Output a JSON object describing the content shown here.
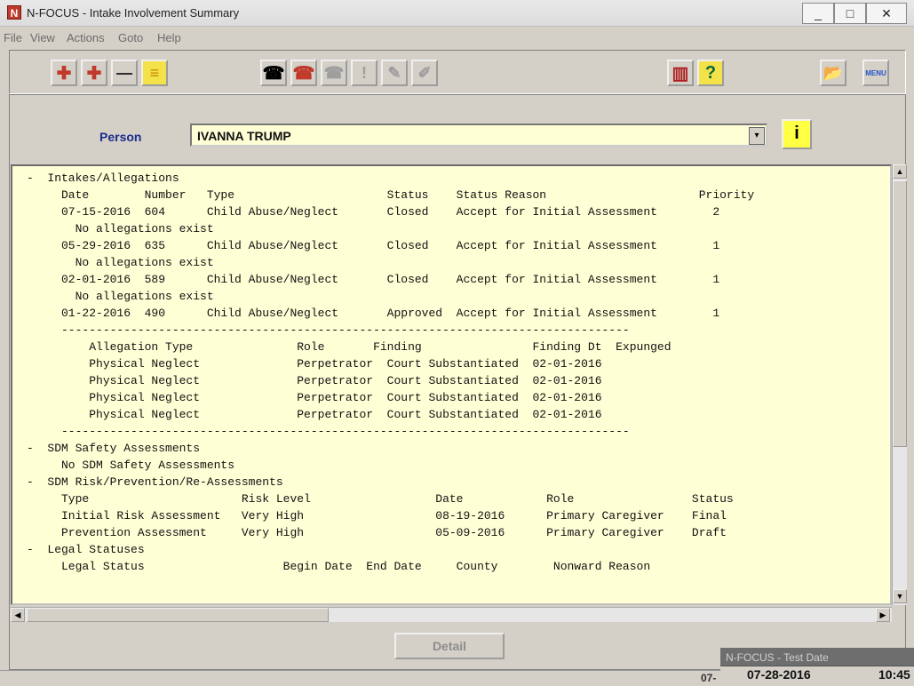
{
  "window": {
    "title": "N-FOCUS - Intake Involvement Summary",
    "icon_letter": "N"
  },
  "window_controls": {
    "minimize": "_",
    "maximize": "□",
    "close": "✕"
  },
  "menu": [
    "File",
    "View",
    "Actions",
    "Goto",
    "Help"
  ],
  "toolbar": {
    "buttons": [
      {
        "name": "add-icon",
        "glyph": "✚"
      },
      {
        "name": "add-multiple-icon",
        "glyph": "✚"
      },
      {
        "name": "remove-icon",
        "glyph": "—"
      },
      {
        "name": "list-icon",
        "glyph": "≡"
      },
      {
        "name": "phone-icon",
        "glyph": "☎"
      },
      {
        "name": "phone-red-icon",
        "glyph": "☎"
      },
      {
        "name": "phone-disabled-icon",
        "glyph": "☎"
      },
      {
        "name": "alert-disabled-icon",
        "glyph": "!"
      },
      {
        "name": "document-disabled-icon",
        "glyph": "✎"
      },
      {
        "name": "notes-disabled-icon",
        "glyph": "✐"
      },
      {
        "name": "chart-icon",
        "glyph": "▥"
      },
      {
        "name": "help-icon",
        "glyph": "?"
      },
      {
        "name": "open-folder-icon",
        "glyph": "📂"
      },
      {
        "name": "menu-icon",
        "glyph": "MENU"
      }
    ]
  },
  "person": {
    "label": "Person",
    "value": "IVANNA TRUMP",
    "dropdown_glyph": "▾",
    "info_glyph": "i"
  },
  "summary_lines": [
    "-  Intakes/Allegations",
    "     Date        Number   Type                      Status    Status Reason                      Priority",
    "     07-15-2016  604      Child Abuse/Neglect       Closed    Accept for Initial Assessment        2",
    "       No allegations exist",
    "     05-29-2016  635      Child Abuse/Neglect       Closed    Accept for Initial Assessment        1",
    "       No allegations exist",
    "     02-01-2016  589      Child Abuse/Neglect       Closed    Accept for Initial Assessment        1",
    "       No allegations exist",
    "     01-22-2016  490      Child Abuse/Neglect       Approved  Accept for Initial Assessment        1",
    "     ----------------------------------------------------------------------------------",
    "         Allegation Type               Role       Finding                Finding Dt  Expunged",
    "         Physical Neglect              Perpetrator  Court Substantiated  02-01-2016",
    "         Physical Neglect              Perpetrator  Court Substantiated  02-01-2016",
    "         Physical Neglect              Perpetrator  Court Substantiated  02-01-2016",
    "         Physical Neglect              Perpetrator  Court Substantiated  02-01-2016",
    "     ----------------------------------------------------------------------------------",
    "-  SDM Safety Assessments",
    "     No SDM Safety Assessments",
    "-  SDM Risk/Prevention/Re-Assessments",
    "     Type                      Risk Level                  Date            Role                 Status",
    "     Initial Risk Assessment   Very High                   08-19-2016      Primary Caregiver    Final",
    "     Prevention Assessment     Very High                   05-09-2016      Primary Caregiver    Draft",
    "-  Legal Statuses",
    "     Legal Status                    Begin Date  End Date     County        Nonward Reason"
  ],
  "scrollbars": {
    "up": "▲",
    "down": "▼",
    "left": "◀",
    "right": "▶"
  },
  "detail_button": "Detail",
  "status": {
    "test_date_label": "N-FOCUS - Test Date",
    "test_date": "07-28-2016",
    "time": "10:45",
    "stray_text": "07-"
  }
}
